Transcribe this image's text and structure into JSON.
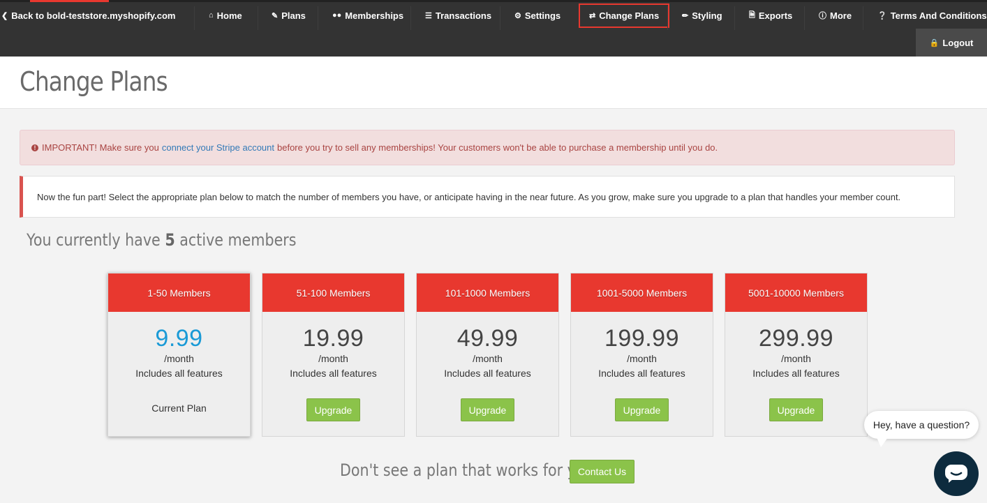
{
  "nav": {
    "back": "Back to bold-teststore.myshopify.com",
    "items": [
      {
        "label": "Home",
        "icon": "home-icon"
      },
      {
        "label": "Plans",
        "icon": "edit-icon"
      },
      {
        "label": "Memberships",
        "icon": "users-icon"
      },
      {
        "label": "Transactions",
        "icon": "list-icon"
      },
      {
        "label": "Settings",
        "icon": "cogs-icon"
      },
      {
        "label": "Change Plans",
        "icon": "exchange-icon"
      },
      {
        "label": "Styling",
        "icon": "brush-icon"
      },
      {
        "label": "Exports",
        "icon": "file-icon"
      },
      {
        "label": "More",
        "icon": "info-icon"
      },
      {
        "label": "Terms And Conditions",
        "icon": "question-icon"
      }
    ],
    "active": "Change Plans",
    "logout": "Logout"
  },
  "page": {
    "title": "Change Plans"
  },
  "alert": {
    "prefix": "IMPORTANT! Make sure you",
    "link": "connect your Stripe account",
    "suffix": "before you try to sell any memberships! Your customers won't be able to purchase a membership until you do."
  },
  "callout": "Now the fun part! Select the appropriate plan below to match the number of members you have, or anticipate having in the near future. As you grow, make sure you upgrade to a plan that handles your member count.",
  "members": {
    "prefix": "You currently have",
    "count": "5",
    "suffix": "active members"
  },
  "plans": [
    {
      "name": "1-50 Members",
      "price": "9.99",
      "per": "/month",
      "features": "Includes all features",
      "status": "Current Plan"
    },
    {
      "name": "51-100 Members",
      "price": "19.99",
      "per": "/month",
      "features": "Includes all features",
      "action": "Upgrade"
    },
    {
      "name": "101-1000 Members",
      "price": "49.99",
      "per": "/month",
      "features": "Includes all features",
      "action": "Upgrade"
    },
    {
      "name": "1001-5000 Members",
      "price": "199.99",
      "per": "/month",
      "features": "Includes all features",
      "action": "Upgrade"
    },
    {
      "name": "5001-10000 Members",
      "price": "299.99",
      "per": "/month",
      "features": "Includes all features",
      "action": "Upgrade"
    }
  ],
  "cta": {
    "text": "Don't see a plan that works for you?",
    "button": "Contact Us"
  },
  "chat": {
    "bubble": "Hey, have a question?"
  },
  "colors": {
    "nav_bg": "#333333",
    "accent_red": "#e8382f",
    "green": "#8bc34a",
    "price_current": "#1a9ad6",
    "chat_btn": "#0d2b3e"
  }
}
